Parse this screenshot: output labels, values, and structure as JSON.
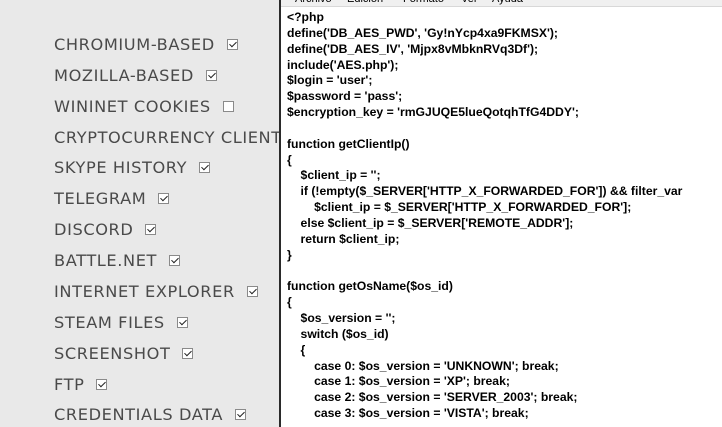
{
  "options": [
    {
      "label": "CHROMIUM-BASED",
      "checked": true
    },
    {
      "label": "MOZILLA-BASED",
      "checked": true
    },
    {
      "label": "WININET COOKIES",
      "checked": false
    },
    {
      "label": "CRYPTOCURRENCY CLIENTS",
      "checked": true
    },
    {
      "label": "SKYPE HISTORY",
      "checked": true
    },
    {
      "label": "TELEGRAM",
      "checked": true
    },
    {
      "label": "DISCORD",
      "checked": true
    },
    {
      "label": "BATTLE.NET",
      "checked": true
    },
    {
      "label": "INTERNET EXPLORER",
      "checked": true
    },
    {
      "label": "STEAM FILES",
      "checked": true
    },
    {
      "label": "SCREENSHOT",
      "checked": true
    },
    {
      "label": "FTP",
      "checked": true
    },
    {
      "label": "CREDENTIALS DATA",
      "checked": true
    }
  ],
  "editor": {
    "menu": [
      "Archivo",
      "Edición",
      "Formato",
      "Ver",
      "Ayuda"
    ],
    "lines": [
      "<?php",
      "define('DB_AES_PWD', 'Gy!nYcp4xa9FKMSX');",
      "define('DB_AES_IV', 'Mjpx8vMbknRVq3Df');",
      "include('AES.php');",
      "$login = 'user';",
      "$password = 'pass';",
      "$encryption_key = 'rmGJUQE5lueQotqhTfG4DDY';",
      "",
      "function getClientIp()",
      "{",
      "    $client_ip = '';",
      "    if (!empty($_SERVER['HTTP_X_FORWARDED_FOR']) && filter_var",
      "        $client_ip = $_SERVER['HTTP_X_FORWARDED_FOR'];",
      "    else $client_ip = $_SERVER['REMOTE_ADDR'];",
      "    return $client_ip;",
      "}",
      "",
      "function getOsName($os_id)",
      "{",
      "    $os_version = '';",
      "    switch ($os_id)",
      "    {",
      "        case 0: $os_version = 'UNKNOWN'; break;",
      "        case 1: $os_version = 'XP'; break;",
      "        case 2: $os_version = 'SERVER_2003'; break;",
      "        case 3: $os_version = 'VISTA'; break;"
    ]
  }
}
